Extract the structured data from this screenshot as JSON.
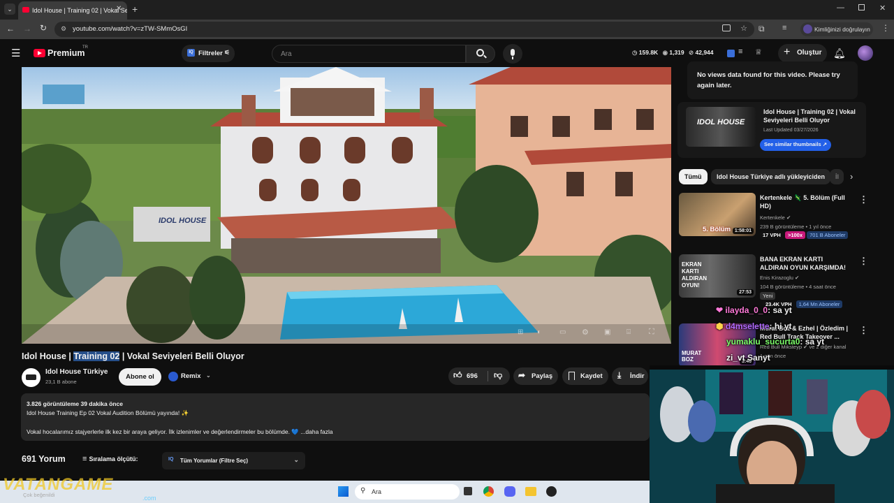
{
  "browser": {
    "tab_title": "Idol House | Training 02 | Vokal Sev...",
    "url": "youtube.com/watch?v=zTW-SMmOsGI",
    "verify_label": "Kimliğinizi doğrulayın"
  },
  "header": {
    "logo_text": "Premium",
    "logo_region": "TR",
    "filters_label": "Filtreler",
    "search_placeholder": "Ara",
    "stat_views": "159.8K",
    "stat_watching": "1,319",
    "stat_subs": "42,944",
    "create_label": "Oluştur"
  },
  "video": {
    "title_pre": "Idol House | ",
    "title_highlight": "Training 02",
    "title_post": " | Vokal Seviyeleri Belli Oluyor",
    "sign_text": "IDOL HOUSE"
  },
  "channel": {
    "name": "Idol House Türkiye",
    "subs": "23,1 B abone",
    "subscribe_label": "Abone ol",
    "remix_label": "Remix"
  },
  "actions": {
    "likes": "696",
    "share": "Paylaş",
    "save": "Kaydet",
    "download": "İndir"
  },
  "description": {
    "stats": "3.826 görüntüleme  39 dakika önce",
    "line1": "Idol House Training Ep 02 Vokal Audition Bölümü yayında! ✨",
    "line2": "Vokal hocalarımız stajyerlerle ilk kez bir araya geliyor. İlk izlenimler ve değerlendirmeler bu bölümde. 💙 ...daha fazla"
  },
  "comments": {
    "count": "691 Yorum",
    "sort_label": "Sıralama ölçütü:",
    "filter_label": "Tüm Yorumlar (Filtre Seç)",
    "partial_text": "Çok beğenildi"
  },
  "sidebar": {
    "no_views_text": "No views data found for this video. Please try again later.",
    "thumb_card": {
      "title": "Idol House | Training 02 | Vokal Seviyeleri Belli Oluyor",
      "updated": "Last Updated 03/27/2026",
      "button": "See similar thumbnails ↗"
    },
    "chips": [
      "Tümü",
      "Idol House Türkiye adlı yükleyiciden",
      "İl"
    ],
    "videos": [
      {
        "title": "Kertenkele 🦎 5. Bölüm (Full HD)",
        "channel": "Kertenkele",
        "meta": "239 B görüntüleme • 1 yıl önce",
        "vph": "17 VPH",
        "badge": ">100x",
        "subs": "701 B Aboneler",
        "duration": "1:58:01",
        "thumb_text": "5. Bölüm"
      },
      {
        "title": "BANA EKRAN KARTI ALDIRAN OYUN KARŞIMDA!",
        "channel": "Enis Kirazoglu",
        "meta": "104 B görüntüleme • 4 saat önce",
        "badge": "Yeni",
        "vph": "23.4K VPH",
        "subs": "1,64 Mn Aboneler",
        "duration": "27:53",
        "thumb_text": "EKRAN KARTI ALDIRAN OYUN!"
      },
      {
        "title": "Murat Boz & Ezhel | Özledim | Red Bull Track Takeover ...",
        "channel": "Red Bull Mikstеyp",
        "meta": "ve 2 diğer kanal",
        "meta2": "1 gün önce",
        "duration": "3:46",
        "thumb_text": "MURAT BOZ"
      }
    ]
  },
  "chat_overlay": [
    {
      "user": "ilayda_0_0",
      "msg": ": sa yt",
      "color": "#ff7ad9"
    },
    {
      "user": "d4mselette",
      "msg": ": hi yt",
      "color": "#b36bff"
    },
    {
      "user": "yumaklu_sucurta0",
      "msg": ": sa yt",
      "color": "#7dff6b"
    },
    {
      "user": "zi_vt",
      "msg": "Sanyt",
      "color": "#ffffff"
    }
  ],
  "watermark": "VATANGAME",
  "watermark_sub": ".com",
  "taskbar": {
    "search_placeholder": "Ara"
  },
  "colors": {
    "bg": "#0f0f0f",
    "yt_red": "#ff0033",
    "accent_blue": "#3ea6ff",
    "chip_active": "#f1f1f1"
  }
}
